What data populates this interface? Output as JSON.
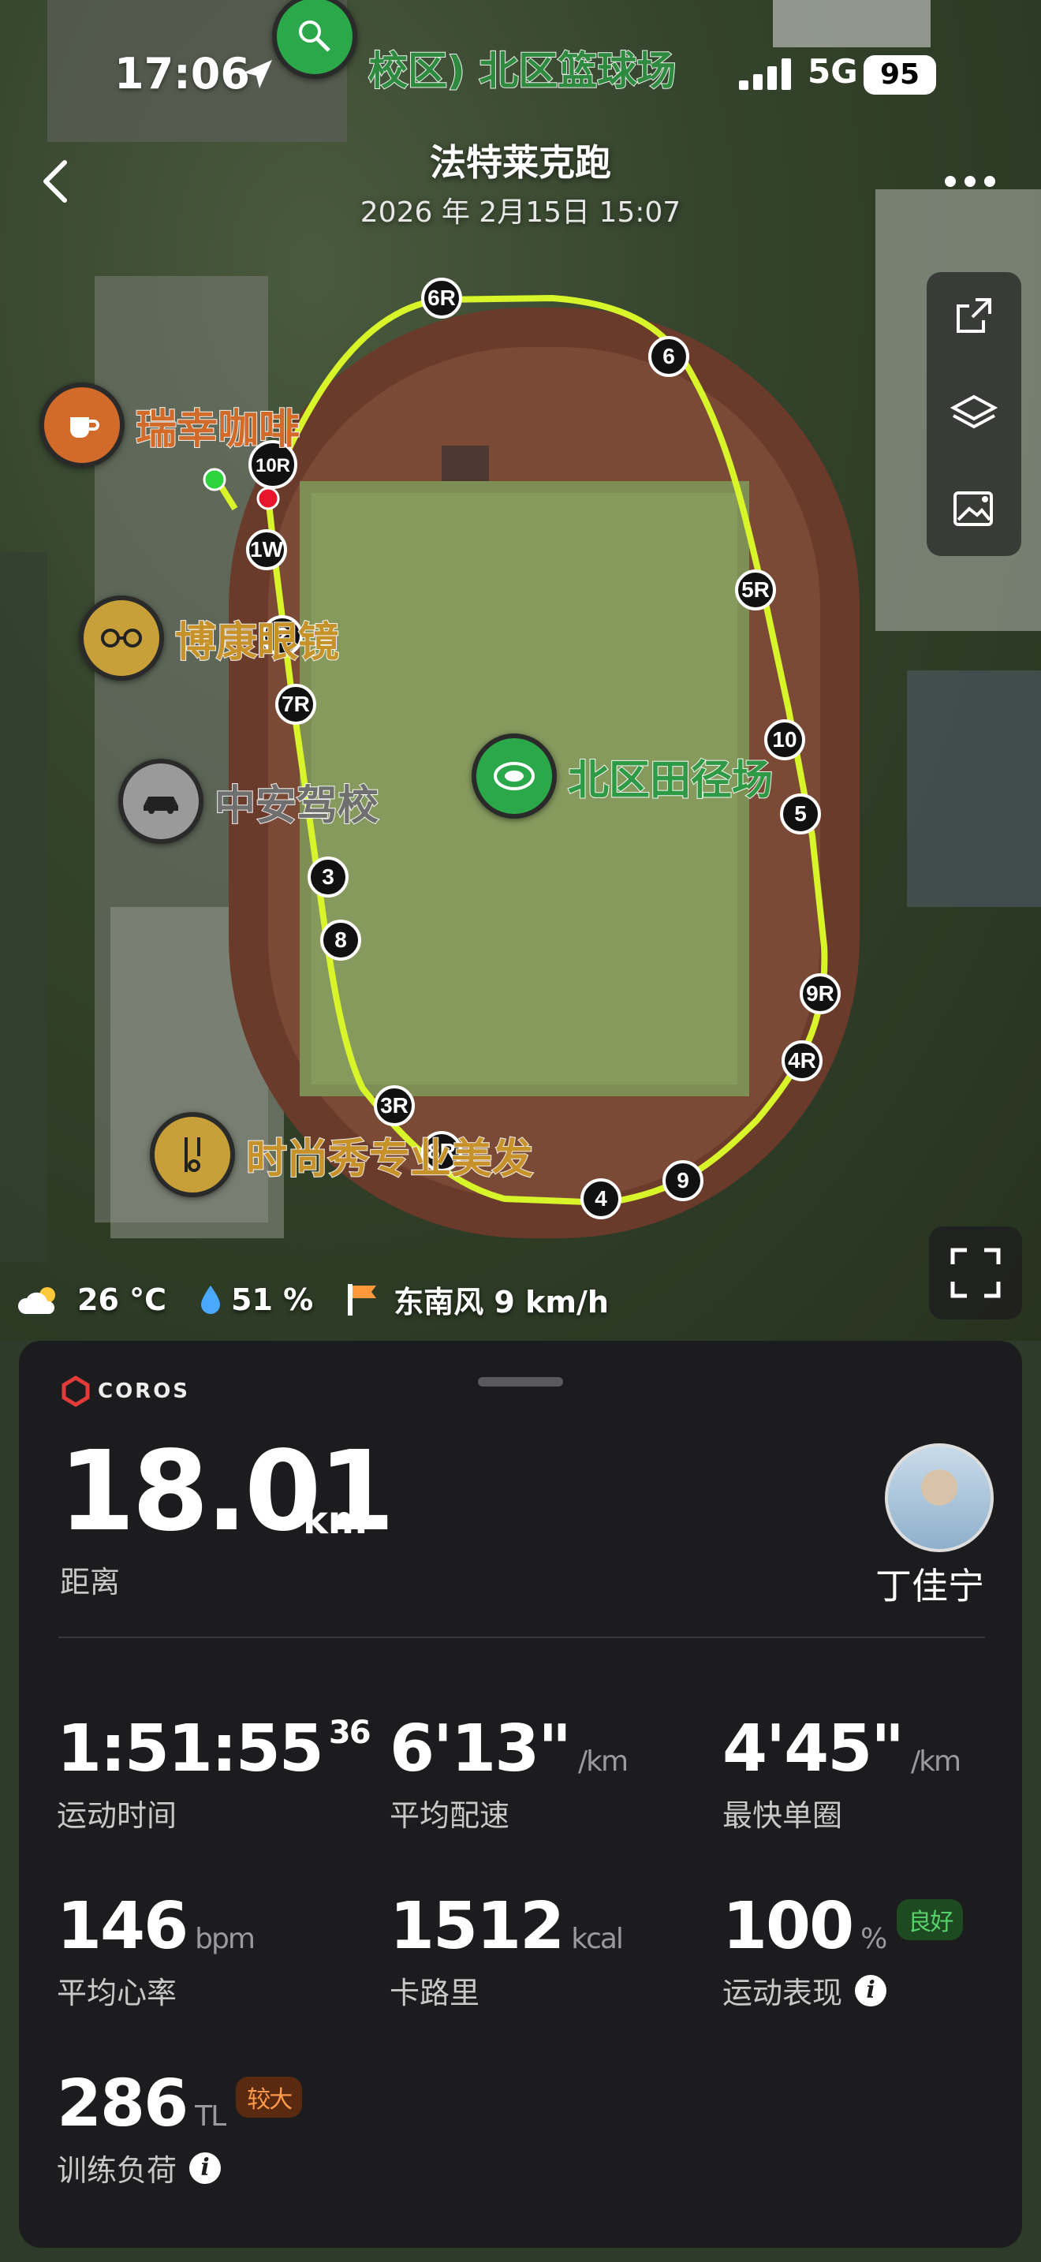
{
  "status_bar": {
    "time": "17:06",
    "network": "5G",
    "battery": "95"
  },
  "header": {
    "title": "法特莱克跑",
    "subtitle": "2026 年 2月15日 15:07"
  },
  "map": {
    "pois": [
      {
        "name": "瑞幸咖啡",
        "icon": "coffee-icon"
      },
      {
        "name": "博康眼镜",
        "icon": "glasses-icon"
      },
      {
        "name": "中安驾校",
        "icon": "car-icon"
      },
      {
        "name": "北区田径场",
        "icon": "stadium-icon"
      },
      {
        "name": "时尚秀专业美发",
        "icon": "hair-salon-icon"
      },
      {
        "name": "校区) 北区篮球场",
        "icon": "tennis-icon"
      }
    ],
    "lap_markers": [
      "6R",
      "6",
      "10R",
      "1W",
      "5R",
      "2",
      "7R",
      "10",
      "5",
      "3",
      "8",
      "9R",
      "4R",
      "3R",
      "8R",
      "9",
      "4"
    ]
  },
  "weather": {
    "temp": "26 °C",
    "humidity": "51 %",
    "wind": "东南风 9 km/h"
  },
  "card": {
    "brand": "COROS",
    "distance": {
      "value": "18.01",
      "unit": "km",
      "label": "距离"
    },
    "user": {
      "name": "丁佳宁"
    },
    "metrics": {
      "time": {
        "value": "1:51:55",
        "sub": "36",
        "label": "运动时间"
      },
      "pace": {
        "value": "6'13\"",
        "unit": "/km",
        "label": "平均配速"
      },
      "fastest_lap": {
        "value": "4'45\"",
        "unit": "/km",
        "label": "最快单圈"
      },
      "heart_rate": {
        "value": "146",
        "unit": "bpm",
        "label": "平均心率"
      },
      "calories": {
        "value": "1512",
        "unit": "kcal",
        "label": "卡路里"
      },
      "performance": {
        "value": "100",
        "unit": "%",
        "badge": "良好",
        "label": "运动表现"
      },
      "training_load": {
        "value": "286",
        "unit": "TL",
        "badge": "较大",
        "label": "训练负荷"
      }
    }
  },
  "colors": {
    "route": "#d8f52a",
    "good": "#57d16a",
    "high": "#ff9a4a",
    "card_bg": "#1c1c1e"
  }
}
